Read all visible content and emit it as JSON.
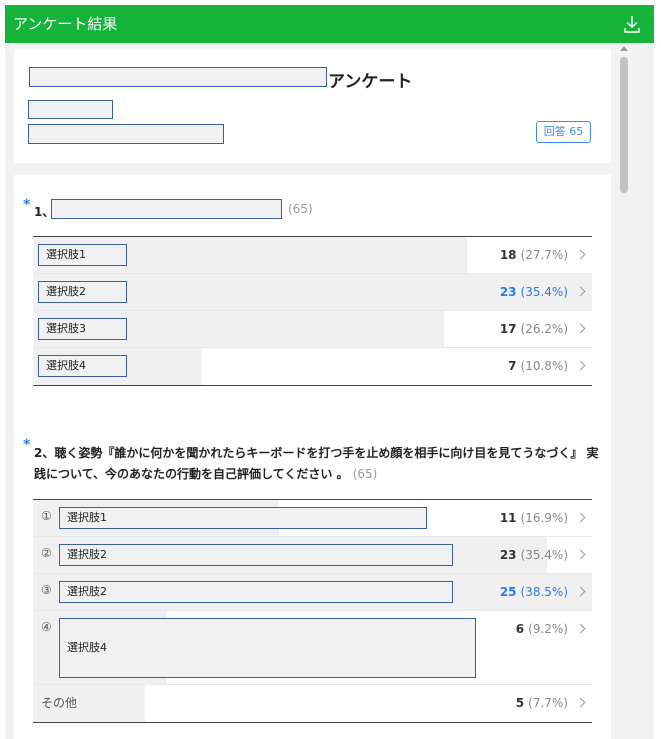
{
  "window": {
    "title": "アンケート結果"
  },
  "header": {
    "survey_title_suffix": "アンケート",
    "answer_badge": "回答 65"
  },
  "questions": [
    {
      "label": "1、",
      "count": "(65)",
      "options": [
        {
          "label": "選択肢1",
          "count": "18",
          "percent": "(27.7%)",
          "highlight": false,
          "share": 0.777
        },
        {
          "label": "選択肢2",
          "count": "23",
          "percent": "(35.4%)",
          "highlight": true,
          "share": 1.0
        },
        {
          "label": "選択肢3",
          "count": "17",
          "percent": "(26.2%)",
          "highlight": false,
          "share": 0.735
        },
        {
          "label": "選択肢4",
          "count": "7",
          "percent": "(10.8%)",
          "highlight": false,
          "share": 0.302
        }
      ]
    },
    {
      "label": "2、聴く姿勢『誰かに何かを聞かれたらキーボードを打つ手を止め顔を相手に向け目を見てうなづく』 実践について、今のあなたの行動を自己評価してください 。",
      "count": "(65)",
      "options": [
        {
          "num": "①",
          "label": "選択肢1",
          "count": "11",
          "percent": "(16.9%)",
          "highlight": false,
          "share": 0.44
        },
        {
          "num": "②",
          "label": "選択肢2",
          "count": "23",
          "percent": "(35.4%)",
          "highlight": false,
          "share": 0.92
        },
        {
          "num": "③",
          "label": "選択肢2",
          "count": "25",
          "percent": "(38.5%)",
          "highlight": true,
          "share": 1.0
        },
        {
          "num": "④",
          "label": "選択肢4",
          "count": "6",
          "percent": "(9.2%)",
          "highlight": false,
          "share": 0.24
        },
        {
          "num": "",
          "label": "その他",
          "count": "5",
          "percent": "(7.7%)",
          "highlight": false,
          "share": 0.2
        }
      ]
    }
  ]
}
